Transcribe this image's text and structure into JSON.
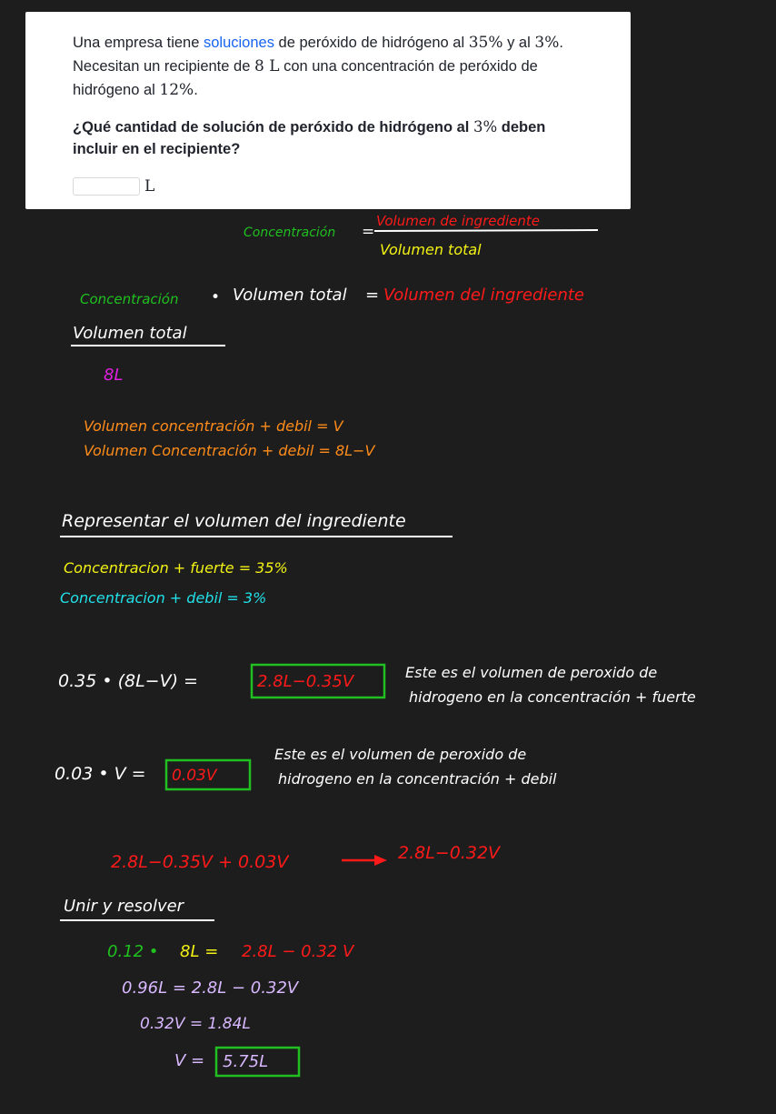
{
  "problem": {
    "p1": "Una empresa tiene ",
    "link": "soluciones",
    "p2": " de peróxido de hidrógeno al ",
    "pct1": "35%",
    "p3": " y al ",
    "pct2": "3%",
    "p4": ". Necesitan un recipiente de ",
    "vol": "8 L",
    "p5": " con una concentración de peróxido de hidrógeno al ",
    "pct3": "12%",
    "p6": "."
  },
  "question": {
    "q1": "¿Qué cantidad de solución de peróxido de hidrógeno al ",
    "pct": "3%",
    "q2": " deben incluir en el recipiente?"
  },
  "answer": {
    "value": "",
    "unit": "L"
  },
  "notes": {
    "formula_left": "Concentración",
    "formula_eq": "=",
    "formula_num": "Volumen de ingrediente",
    "formula_den": "Volumen total",
    "line2_a": "Concentración",
    "line2_dot": "•",
    "line2_b": "Volumen total",
    "line2_eq": "=",
    "line2_c": "Volumen del ingrediente",
    "vt_heading": "Volumen total",
    "vt_value": "8L",
    "weak_vol": "Volumen concentración + debil = V",
    "strong_vol": "Volumen Concentración + debil = 8L−V",
    "rep_heading": "Representar el volumen del ingrediente",
    "strong_conc": "Concentracion + fuerte = 35%",
    "weak_conc": "Concentracion + debil = 3%",
    "eq1_left": "0.35 • (8L−V) =",
    "eq1_box": "2.8L−0.35V",
    "eq1_note1": "Este es el volumen de peroxido de",
    "eq1_note2": "hidrogeno en la concentración + fuerte",
    "eq2_left": "0.03 • V =",
    "eq2_box": "0.03V",
    "eq2_note1": "Este es el volumen de peroxido de",
    "eq2_note2": "hidrogeno en la concentración + debil",
    "sum_left": "2.8L−0.35V + 0.03V",
    "sum_right": "2.8L−0.32V",
    "solve_heading": "Unir y resolver",
    "s1_a": "0.12 •",
    "s1_b": "8L =",
    "s1_c": "2.8L − 0.32 V",
    "s2": "0.96L = 2.8L − 0.32V",
    "s3": "0.32V = 1.84L",
    "s4_left": "V =",
    "s4_box": "5.75L"
  },
  "colors": {
    "green": "#20c020",
    "red": "#ff1a1a",
    "white": "#ffffff",
    "magenta": "#e020e0",
    "orange": "#ff8c1a",
    "yellow": "#f2f215",
    "cyan": "#22e0e8",
    "lavender": "#d8b8ff",
    "khan_blue": "#1865f2"
  }
}
